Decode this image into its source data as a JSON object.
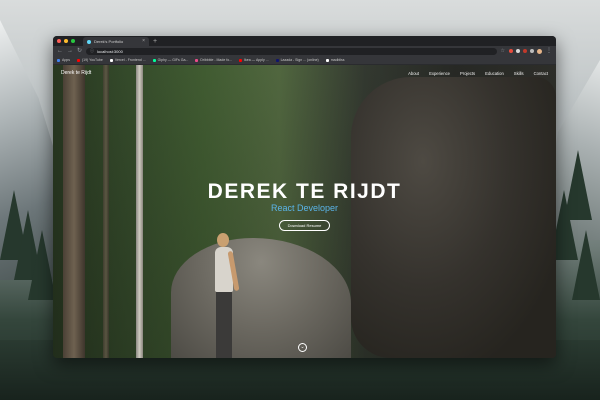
{
  "browser": {
    "tab_title": "Derek's Portfolio",
    "url": "localhost:3000",
    "bookmarks": [
      {
        "label": "Apps",
        "color": "#4285f4"
      },
      {
        "label": "(19) YouTube",
        "color": "#ff0000"
      },
      {
        "label": "Vercel - Frontend ...",
        "color": "#ffffff"
      },
      {
        "label": "Giphy — GIFs Ga...",
        "color": "#00ff99"
      },
      {
        "label": "Dribbble - Made fo...",
        "color": "#ea4c89"
      },
      {
        "label": "Ikea — Apply ...",
        "color": "#ff0000"
      },
      {
        "label": "Lazada - Sign ... (online)",
        "color": "#0f146d"
      },
      {
        "label": "madbliss",
        "color": "#ffffff"
      }
    ]
  },
  "site": {
    "brand": "Derek te Rijdt",
    "nav": [
      "About",
      "Experience",
      "Projects",
      "Education",
      "Skills",
      "Contact"
    ],
    "hero": {
      "name": "DEREK TE RIJDT",
      "role": "React Developer",
      "cta": "Download Resume"
    }
  },
  "colors": {
    "accent": "#5ab4e8"
  }
}
